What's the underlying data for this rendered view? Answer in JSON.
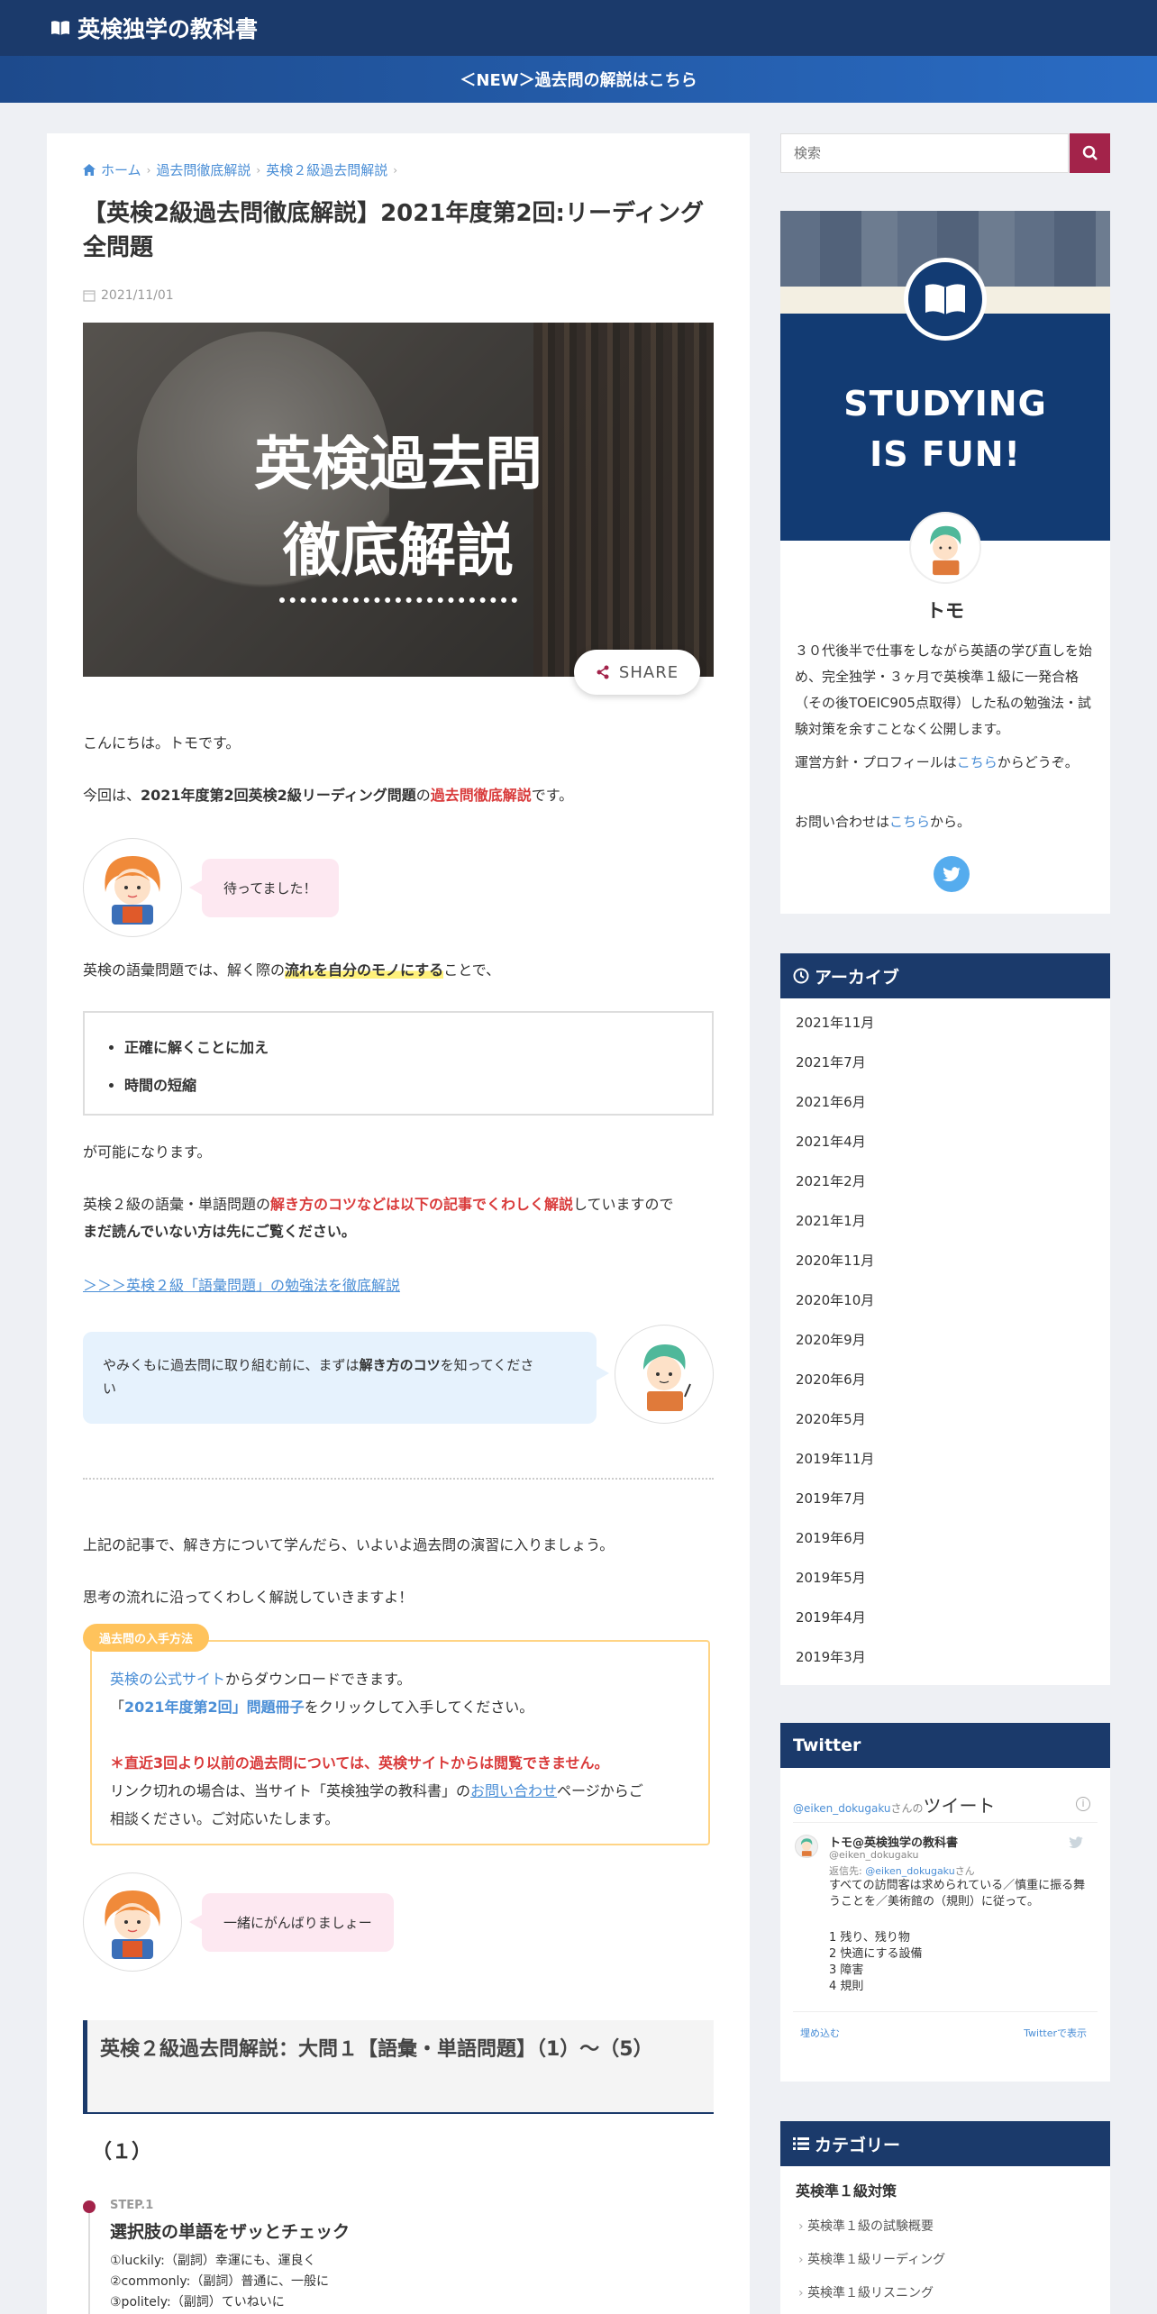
{
  "header": {
    "site_title": "英検独学の教科書",
    "news": "＜NEW＞過去問の解説はこちら"
  },
  "breadcrumb": [
    "ホーム",
    "過去問徹底解説",
    "英検２級過去問解説"
  ],
  "post": {
    "title": "【英検2級過去問徹底解説】2021年度第2回:リーディング全問題",
    "date": "2021/11/01",
    "hero_line1": "英検過去問",
    "hero_line2": "徹底解説",
    "share": "SHARE"
  },
  "body": {
    "greeting": "こんにちは。トモです。",
    "intro_a": "今回は、",
    "intro_b": "2021年度第2回英検2級リーディング問題",
    "intro_c": "の",
    "intro_d": "過去問徹底解説",
    "intro_e": "です。",
    "bubble1": "待ってました！",
    "vocab_a": "英検の語彙問題では、解く際の",
    "vocab_b": "流れを自分のモノにする",
    "vocab_c": "ことで、",
    "check_items": [
      "正確に解くことに加え",
      "時間の短縮"
    ],
    "possible": "が可能になります。",
    "tips_a": "英検２級の語彙・単語問題の",
    "tips_b": "解き方のコツなどは以下の記事でくわしく解説",
    "tips_c": "していますので",
    "tips_d": "まだ読んでいない方は先にご覧ください。",
    "link_vocab": "＞＞＞英検２級「語彙問題」の勉強法を徹底解説",
    "bubble2_a": "やみくもに過去問に取り組む前に、まずは",
    "bubble2_b": "解き方のコツ",
    "bubble2_c": "を知ってくださ",
    "bubble2_d": "い",
    "after1": "上記の記事で、解き方について学んだら、いよいよ過去問の演習に入りましょう。",
    "after2": "思考の流れに沿ってくわしく解説していきますよ！",
    "source_tag": "過去問の入手方法",
    "source_1a": "英検の公式サイト",
    "source_1b": "からダウンロードできます。",
    "source_2a": "「",
    "source_2b": "2021年度第2回」問題冊子",
    "source_2c": "をクリックして入手してください。",
    "source_3": "＊直近3回より以前の過去問については、英検サイトからは閲覧できません。",
    "source_4a": "リンク切れの場合は、当サイト「英検独学の教科書」の",
    "source_4b": "お問い合わせ",
    "source_4c": "ページからご",
    "source_5": "相談ください。ご対応いたします。",
    "bubble3": "一緒にがんばりましょー",
    "h2": "英検２級過去問解説：大問１【語彙・単語問題】（1）〜（5）",
    "h3": "（１）",
    "step_label": "STEP.1",
    "step_title": "選択肢の単語をザッとチェック",
    "step_items": [
      "①luckily:（副詞）幸運にも、運良く",
      "②commonly:（副詞）普通に、一般に",
      "③politely:（副詞）ていねいに"
    ]
  },
  "sidebar": {
    "search_placeholder": "検索",
    "studying_1": "STUDYING",
    "studying_2": "IS FUN!",
    "profile_name": "トモ",
    "profile_desc": "３０代後半で仕事をしながら英語の学び直しを始め、完全独学・３ヶ月で英検準１級に一発合格（その後TOEIC905点取得）した私の勉強法・試験対策を余すことなく公開します。",
    "policy_a": "運営方針・プロフィールは",
    "policy_b": "こちら",
    "policy_c": "からどうぞ。",
    "contact_a": "お問い合わせは",
    "contact_b": "こちら",
    "contact_c": "から。",
    "archive_title": "アーカイブ",
    "archives": [
      "2021年11月",
      "2021年7月",
      "2021年6月",
      "2021年4月",
      "2021年2月",
      "2021年1月",
      "2020年11月",
      "2020年10月",
      "2020年9月",
      "2020年6月",
      "2020年5月",
      "2019年11月",
      "2019年7月",
      "2019年6月",
      "2019年5月",
      "2019年4月",
      "2019年3月"
    ],
    "twitter_title": "Twitter",
    "tw_handle_link": "@eiken_dokugaku",
    "tw_handle_suffix": "さんの",
    "tw_tweet_label": "ツイート",
    "tw_name": "トモ@英検独学の教科書",
    "tw_handle": "@eiken_dokugaku",
    "tw_reply_a": "返信先: ",
    "tw_reply_b": "@eiken_dokugaku",
    "tw_reply_c": "さん",
    "tw_body": "すべての訪問客は求められている／慎重に振る舞うことを／美術館の（規則）に従って。",
    "tw_list": [
      "1 残り、残り物",
      "2 快適にする設備",
      "3 障害",
      "4 規則"
    ],
    "tw_embed": "埋め込む",
    "tw_view": "Twitterで表示",
    "category_title": "カテゴリー",
    "cat_parent": "英検準１級対策",
    "cat_children": [
      "英検準１級の試験概要",
      "英検準１級リーディング",
      "英検準１級リスニング"
    ]
  }
}
